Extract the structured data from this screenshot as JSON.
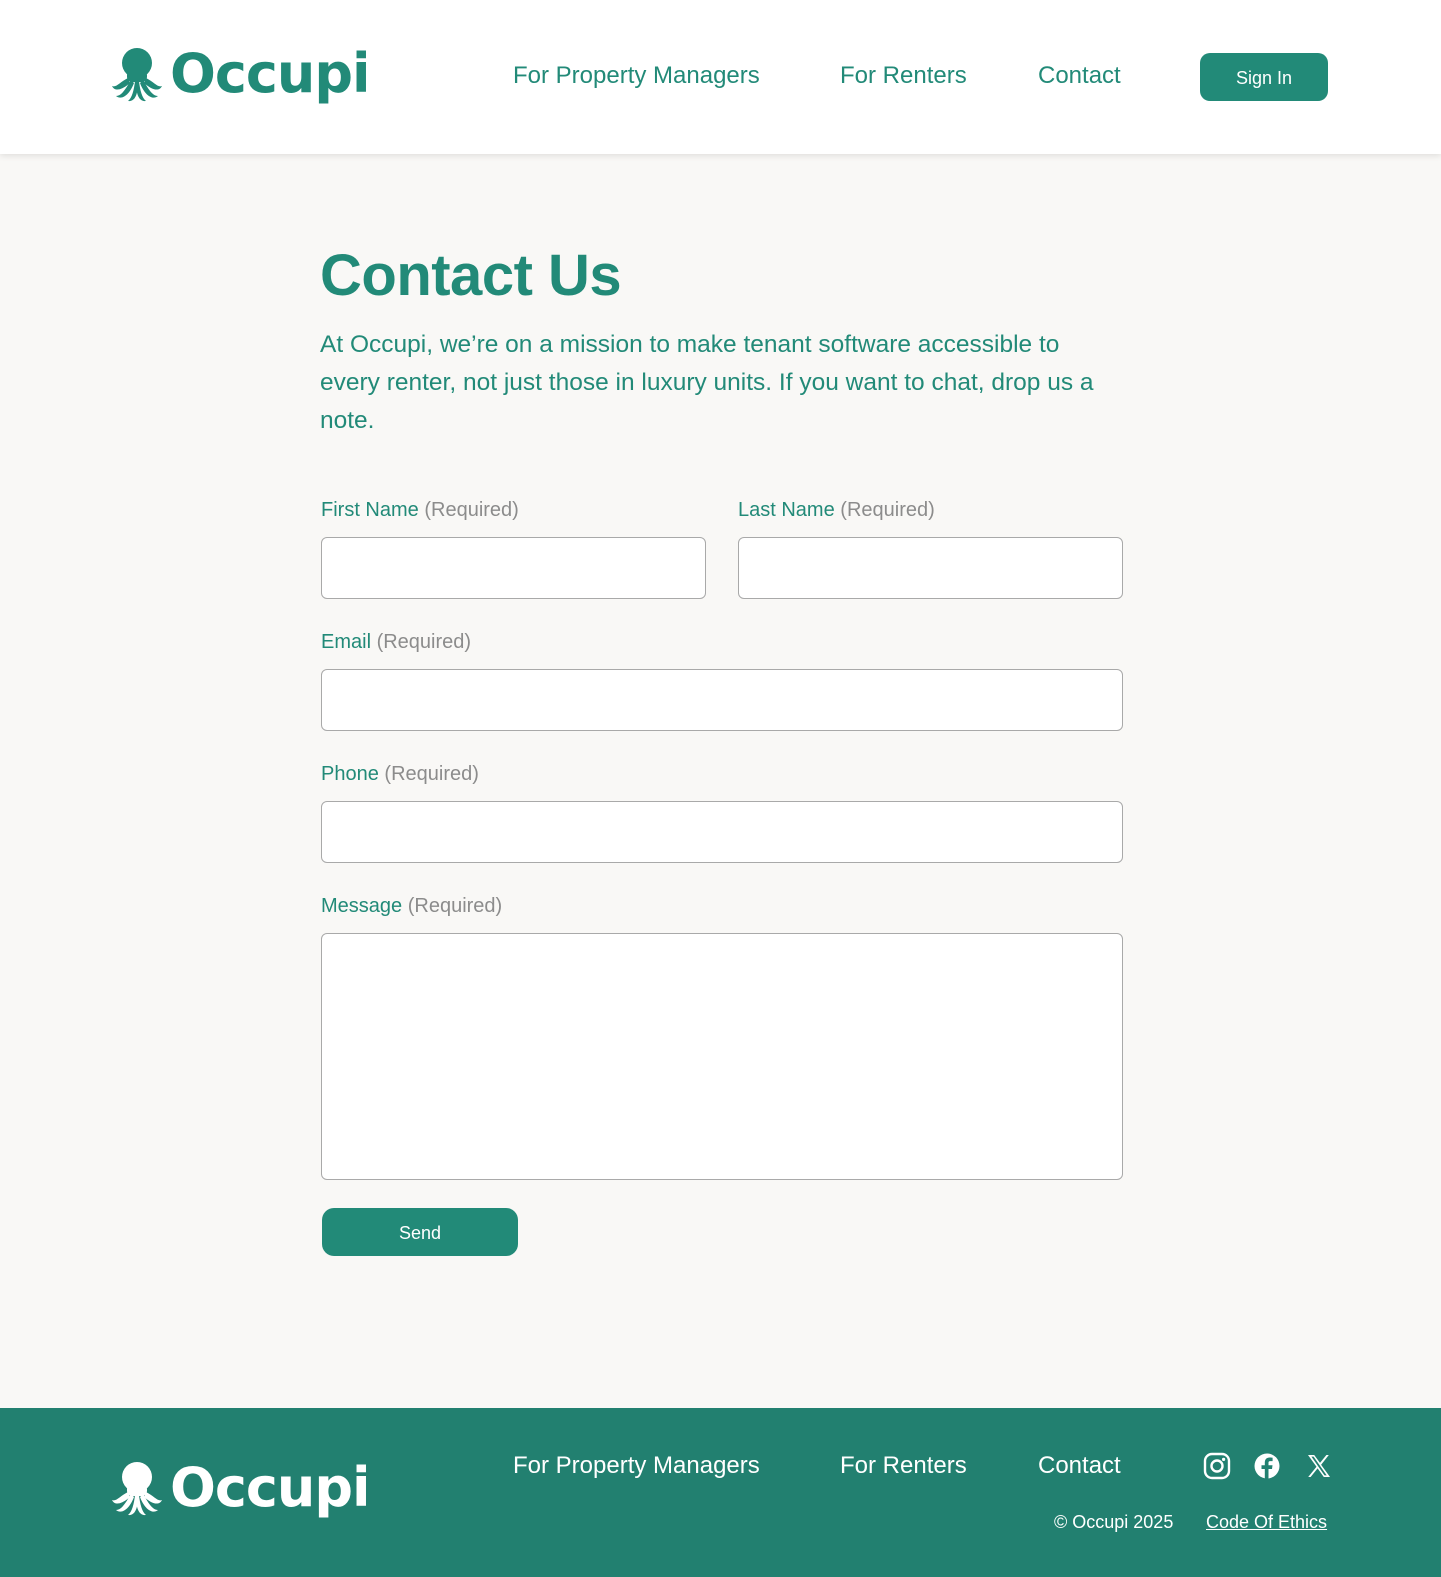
{
  "brand": {
    "name": "Occupi",
    "primary_color": "#228a78",
    "footer_color": "#228070",
    "logo_icon": "octopus-icon"
  },
  "header": {
    "nav": [
      {
        "label": "For Property Managers"
      },
      {
        "label": "For Renters"
      },
      {
        "label": "Contact"
      }
    ],
    "sign_in_label": "Sign In"
  },
  "main": {
    "title": "Contact Us",
    "intro": "At Occupi, we’re on a mission to make tenant software accessible to every renter, not just those in luxury units. If you want to chat, drop us a note.",
    "required_text": "(Required)",
    "fields": {
      "first_name": {
        "label": "First Name",
        "value": ""
      },
      "last_name": {
        "label": "Last Name",
        "value": ""
      },
      "email": {
        "label": "Email",
        "value": ""
      },
      "phone": {
        "label": "Phone",
        "value": ""
      },
      "message": {
        "label": "Message",
        "value": ""
      }
    },
    "send_label": "Send"
  },
  "footer": {
    "nav": [
      {
        "label": "For Property Managers"
      },
      {
        "label": "For Renters"
      },
      {
        "label": "Contact"
      }
    ],
    "social": [
      "instagram-icon",
      "facebook-icon",
      "x-icon"
    ],
    "copyright": "© Occupi 2025",
    "ethics_label": "Code Of Ethics"
  }
}
